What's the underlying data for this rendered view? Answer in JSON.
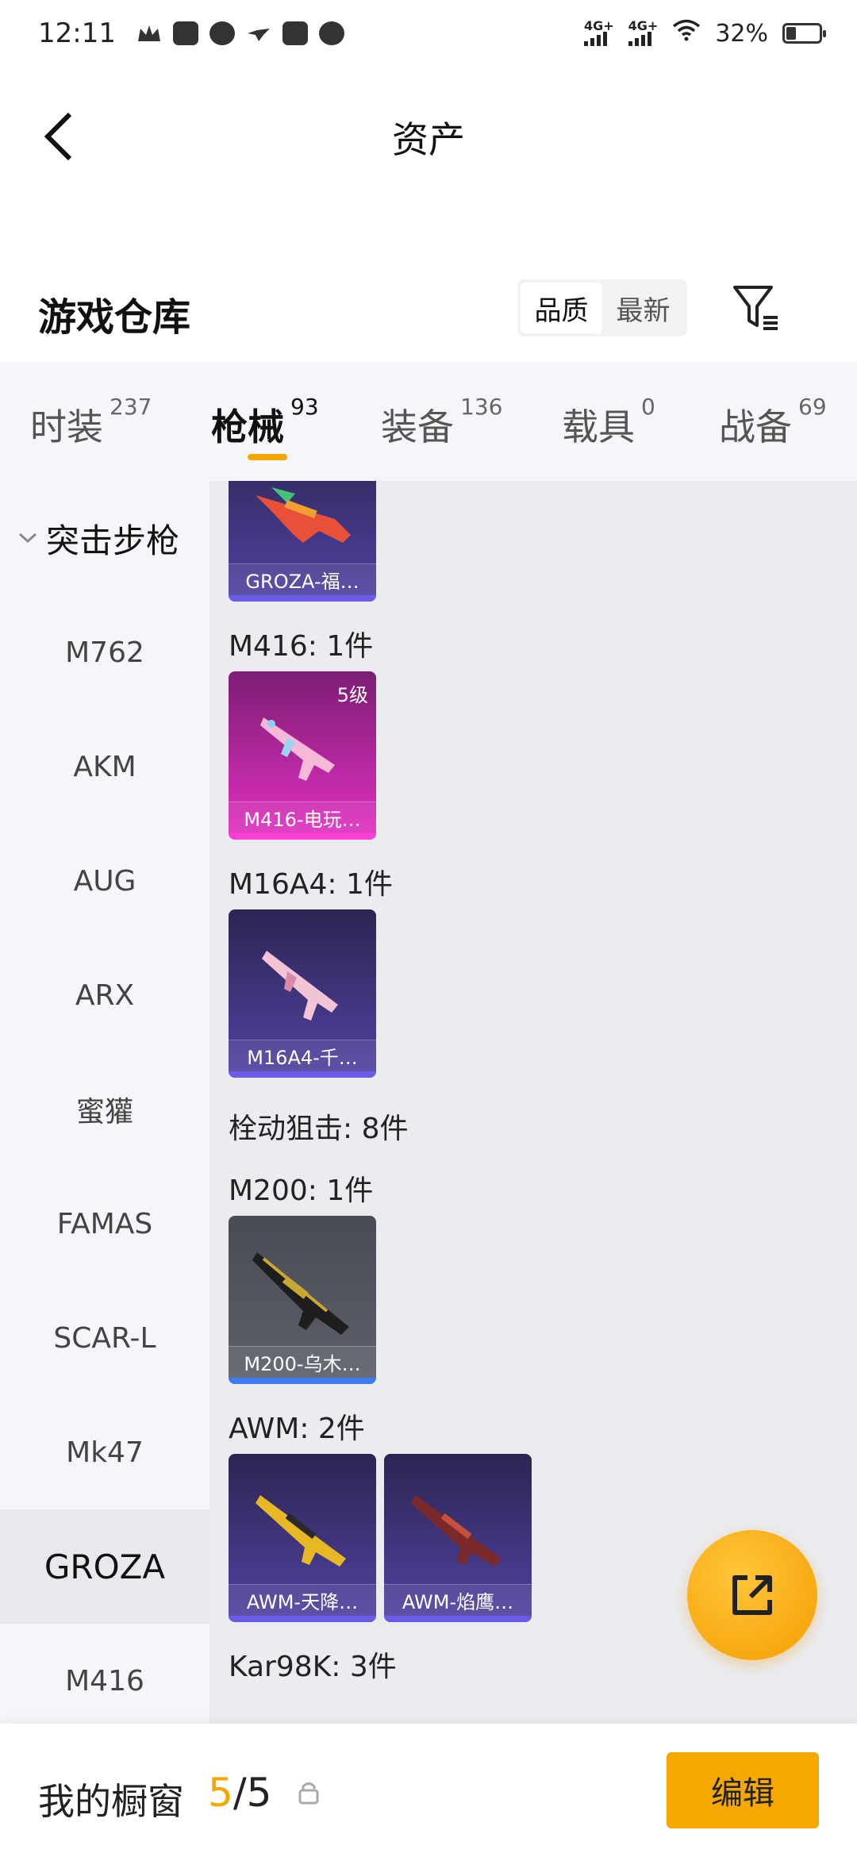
{
  "status_bar": {
    "time": "12:11",
    "battery": "32%",
    "net1": "4G+",
    "net2": "4G+"
  },
  "nav": {
    "title": "资产"
  },
  "header": {
    "title": "游戏仓库",
    "sort_quality": "品质",
    "sort_newest": "最新"
  },
  "tabs": [
    {
      "label": "时装",
      "count": "237"
    },
    {
      "label": "枪械",
      "count": "93"
    },
    {
      "label": "装备",
      "count": "136"
    },
    {
      "label": "载具",
      "count": "0"
    },
    {
      "label": "战备",
      "count": "69"
    }
  ],
  "side_nav": {
    "group": "突击步枪",
    "items": [
      "M762",
      "AKM",
      "AUG",
      "ARX",
      "蜜獾",
      "FAMAS",
      "SCAR-L",
      "Mk47",
      "GROZA",
      "M416"
    ]
  },
  "list": {
    "groza_card": "GROZA-福…",
    "m416_label": "M416: 1件",
    "m416_card": "M416-电玩…",
    "m416_level": "5级",
    "m16_label": "M16A4: 1件",
    "m16_card": "M16A4-千…",
    "bolt_label": "栓动狙击: 8件",
    "m200_label": "M200: 1件",
    "m200_card": "M200-乌木…",
    "awm_label": "AWM: 2件",
    "awm_card1": "AWM-天降…",
    "awm_card2": "AWM-焰鹰…",
    "kar_label": "Kar98K: 3件"
  },
  "bottom": {
    "label": "我的橱窗",
    "used": "5",
    "total": "5",
    "edit": "编辑"
  },
  "colors": {
    "accent": "#f5a500",
    "purple_card": "#4a3d94",
    "pink_card": "#d22db3"
  }
}
